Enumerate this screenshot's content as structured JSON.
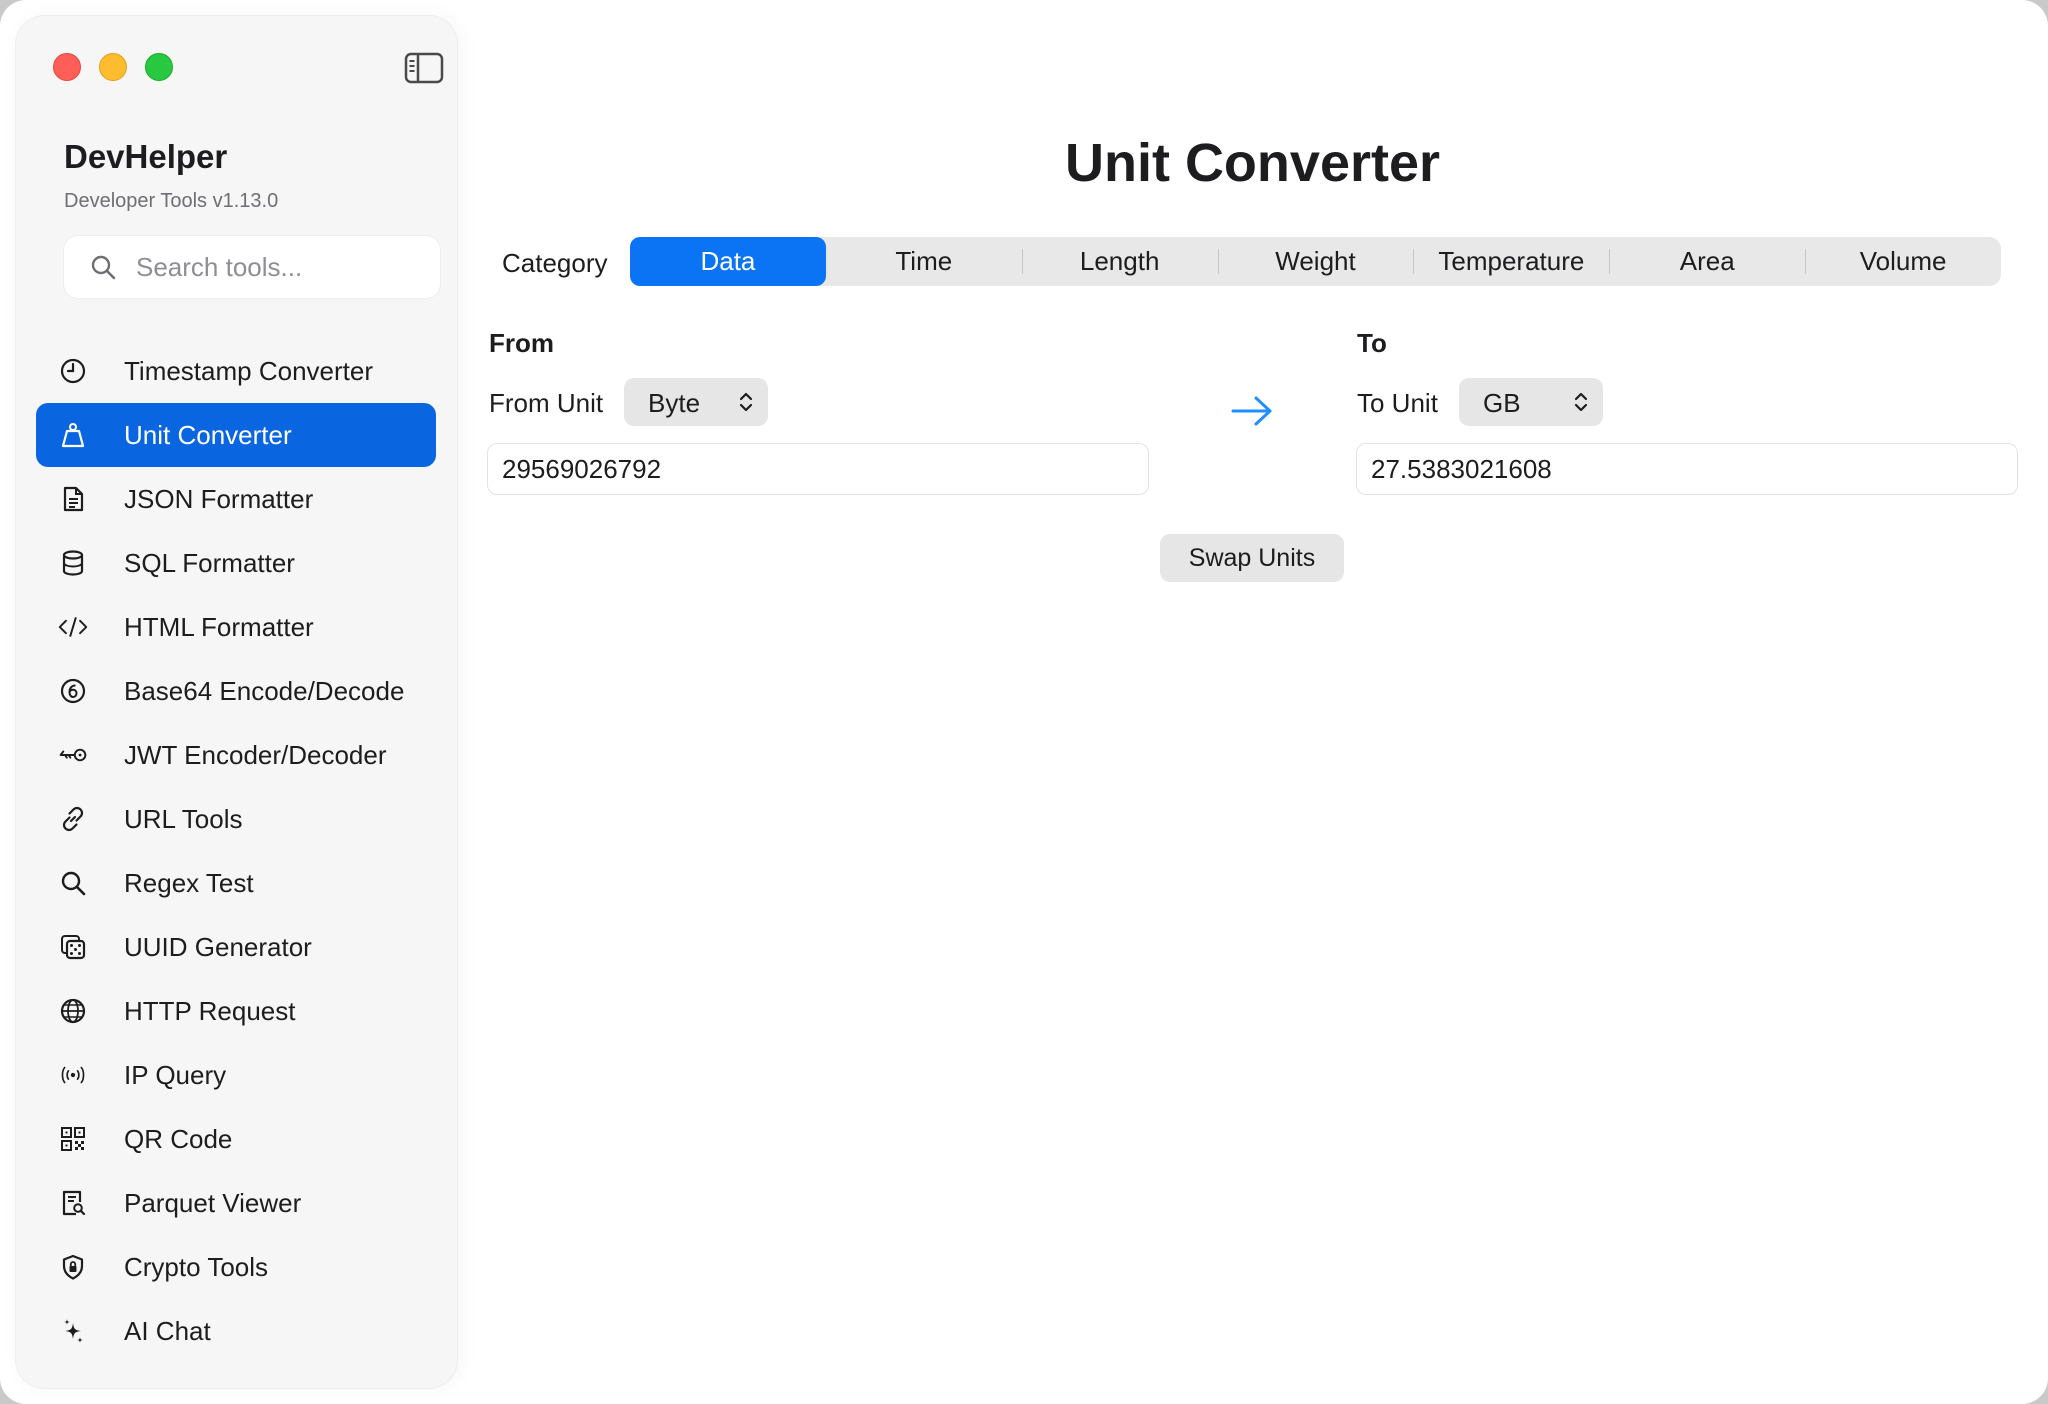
{
  "colors": {
    "accent": "#0a66e0",
    "segment_active": "#0a74f5",
    "arrow": "#1f8fff",
    "close": "#ff5f57",
    "minimize": "#febc2e",
    "zoom": "#28c840"
  },
  "sidebar": {
    "app_name": "DevHelper",
    "app_version": "Developer Tools v1.13.0",
    "search_placeholder": "Search tools...",
    "items": [
      {
        "label": "Timestamp Converter",
        "icon": "clock-icon"
      },
      {
        "label": "Unit Converter",
        "icon": "scale-icon",
        "active": true
      },
      {
        "label": "JSON Formatter",
        "icon": "document-icon"
      },
      {
        "label": "SQL Formatter",
        "icon": "database-icon"
      },
      {
        "label": "HTML Formatter",
        "icon": "code-icon"
      },
      {
        "label": "Base64 Encode/Decode",
        "icon": "circled-six-icon"
      },
      {
        "label": "JWT Encoder/Decoder",
        "icon": "key-icon"
      },
      {
        "label": "URL Tools",
        "icon": "link-icon"
      },
      {
        "label": "Regex Test",
        "icon": "magnifier-icon"
      },
      {
        "label": "UUID Generator",
        "icon": "dice-icon"
      },
      {
        "label": "HTTP Request",
        "icon": "globe-icon"
      },
      {
        "label": "IP Query",
        "icon": "broadcast-icon"
      },
      {
        "label": "QR Code",
        "icon": "qrcode-icon"
      },
      {
        "label": "Parquet Viewer",
        "icon": "doc-search-icon"
      },
      {
        "label": "Crypto Tools",
        "icon": "shield-lock-icon"
      },
      {
        "label": "AI Chat",
        "icon": "sparkles-icon"
      }
    ]
  },
  "main": {
    "title": "Unit Converter",
    "category_label": "Category",
    "categories": [
      "Data",
      "Time",
      "Length",
      "Weight",
      "Temperature",
      "Area",
      "Volume"
    ],
    "selected_category": "Data",
    "from": {
      "title": "From",
      "unit_label": "From Unit",
      "unit": "Byte",
      "value": "29569026792"
    },
    "to": {
      "title": "To",
      "unit_label": "To Unit",
      "unit": "GB",
      "value": "27.5383021608"
    },
    "swap_label": "Swap Units"
  }
}
